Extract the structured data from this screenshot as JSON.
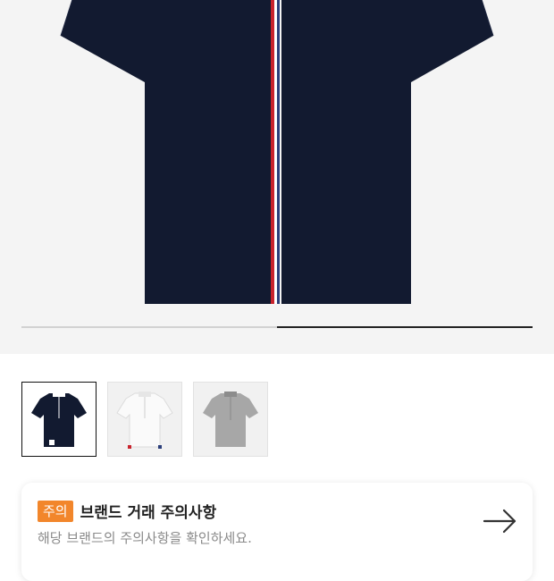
{
  "product_image": {
    "name": "navy-polo-shirt",
    "colors": {
      "background": "#f4f4f4",
      "shirt": "#121a30",
      "stripe_red": "#c9232d",
      "stripe_white": "#ffffff"
    }
  },
  "gallery_progress": {
    "current_fraction_start": 0.5,
    "current_fraction_end": 1.0,
    "colors": {
      "track": "#d2d2d2",
      "fill": "#222222"
    }
  },
  "thumbnails": [
    {
      "name": "navy-polo-thumbnail",
      "color": "#121a30",
      "selected": true
    },
    {
      "name": "white-polo-thumbnail",
      "color": "#eeeeee",
      "selected": false
    },
    {
      "name": "grey-polo-thumbnail",
      "color": "#a7a7a7",
      "selected": false
    }
  ],
  "notice": {
    "badge": "주의",
    "title": "브랜드 거래 주의사항",
    "subtitle": "해당 브랜드의 주의사항을 확인하세요.",
    "icon": "arrow-right-icon",
    "colors": {
      "badge": "#f2862b"
    }
  }
}
